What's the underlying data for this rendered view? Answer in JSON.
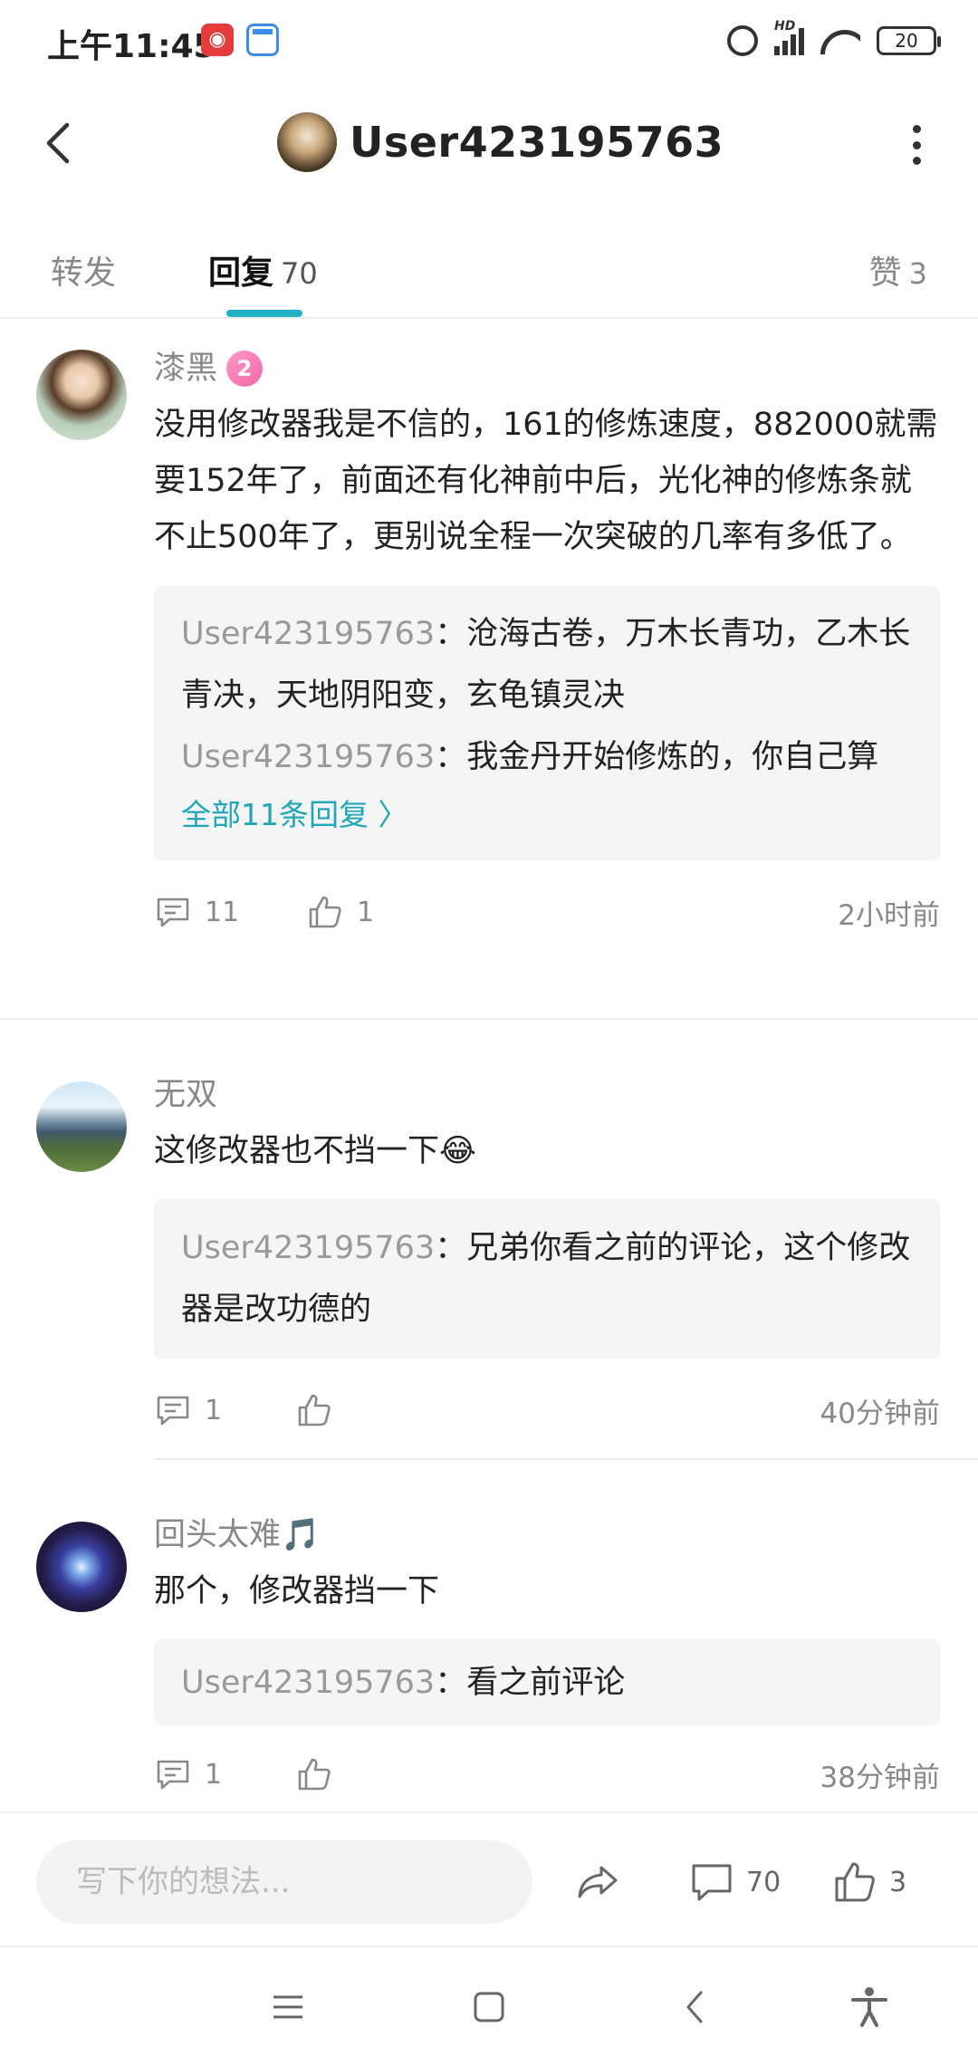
{
  "status_bar": {
    "time": "上午11:45",
    "hd": "HD",
    "battery": "20"
  },
  "header": {
    "title": "User423195763"
  },
  "tabs": {
    "repost": "转发",
    "reply": "回复",
    "reply_count": "70",
    "like": "赞",
    "like_count": "3"
  },
  "comments": [
    {
      "name": "漆黑",
      "badge": "2",
      "text": "没用修改器我是不信的，161的修炼速度，882000就需要152年了，前面还有化神前中后，光化神的修炼条就不止500年了，更别说全程一次突破的几率有多低了。",
      "replies": [
        {
          "user": "User423195763",
          "text": "：沧海古卷，万木长青功，乙木长青决，天地阴阳变，玄龟镇灵决"
        },
        {
          "user": "User423195763",
          "text": "：我金丹开始修炼的，你自己算"
        }
      ],
      "more_replies": "全部11条回复 〉",
      "reply_count": "11",
      "like_count": "1",
      "time": "2小时前"
    },
    {
      "name": "无双",
      "text": "这修改器也不挡一下😂",
      "replies": [
        {
          "user": "User423195763",
          "text": "：兄弟你看之前的评论，这个修改器是改功德的"
        }
      ],
      "reply_count": "1",
      "like_count": "",
      "time": "40分钟前"
    },
    {
      "name": "回头太难🎵",
      "text": "那个，修改器挡一下",
      "replies": [
        {
          "user": "User423195763",
          "text": "：看之前评论"
        }
      ],
      "reply_count": "1",
      "like_count": "",
      "time": "38分钟前"
    }
  ],
  "input_bar": {
    "placeholder": "写下你的想法...",
    "comment_count": "70",
    "like_count": "3"
  },
  "colors": {
    "accent": "#1fb1c4",
    "link": "#1fa7b8"
  }
}
